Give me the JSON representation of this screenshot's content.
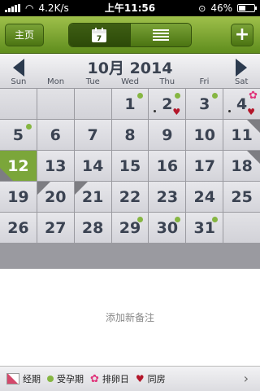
{
  "status_bar": {
    "speed": "4.2K/s",
    "time": "上午11:56",
    "battery": "46%",
    "battery_level": 0.46
  },
  "toolbar": {
    "home_label": "主页",
    "calendar_icon_day": "7",
    "add_label": "+"
  },
  "calendar": {
    "month_title": "10月 2014",
    "weekdays": [
      "Sun",
      "Mon",
      "Tue",
      "Wed",
      "Thu",
      "Fri",
      "Sat"
    ],
    "today": "12",
    "cells": [
      {
        "day": ""
      },
      {
        "day": ""
      },
      {
        "day": ""
      },
      {
        "day": "1",
        "green": true
      },
      {
        "day": "2",
        "green": true,
        "heart": true,
        "dot": true
      },
      {
        "day": "3",
        "green": true
      },
      {
        "day": "4",
        "flower": true,
        "heart": true,
        "dot": true
      },
      {
        "day": "5",
        "green": true
      },
      {
        "day": "6"
      },
      {
        "day": "7"
      },
      {
        "day": "8"
      },
      {
        "day": "9"
      },
      {
        "day": "10"
      },
      {
        "day": "11",
        "tri_tr": true
      },
      {
        "day": "12",
        "today": true,
        "tri_bl": true
      },
      {
        "day": "13"
      },
      {
        "day": "14"
      },
      {
        "day": "15"
      },
      {
        "day": "16"
      },
      {
        "day": "17"
      },
      {
        "day": "18",
        "tri_tr": true
      },
      {
        "day": "19"
      },
      {
        "day": "20",
        "tri_tr_dummy": false,
        "tri_bl_top": true
      },
      {
        "day": "21",
        "tri_bl_top": true
      },
      {
        "day": "22"
      },
      {
        "day": "23"
      },
      {
        "day": "24"
      },
      {
        "day": "25"
      },
      {
        "day": "26"
      },
      {
        "day": "27"
      },
      {
        "day": "28"
      },
      {
        "day": "29",
        "green": true
      },
      {
        "day": "30",
        "green": true
      },
      {
        "day": "31",
        "green": true
      },
      {
        "day": ""
      }
    ]
  },
  "note": {
    "placeholder": "添加新备注"
  },
  "legend": {
    "items": [
      {
        "icon": "period-icon",
        "label": "经期"
      },
      {
        "icon": "fertile-dot-icon",
        "label": "受孕期"
      },
      {
        "icon": "ovulation-flower-icon",
        "label": "排卵日"
      },
      {
        "icon": "heart-icon",
        "label": "同房"
      }
    ]
  },
  "colors": {
    "accent_green": "#7ba63a",
    "heart_red": "#b3162a",
    "flower_pink": "#e0337a",
    "period_pink": "#d4486b"
  }
}
